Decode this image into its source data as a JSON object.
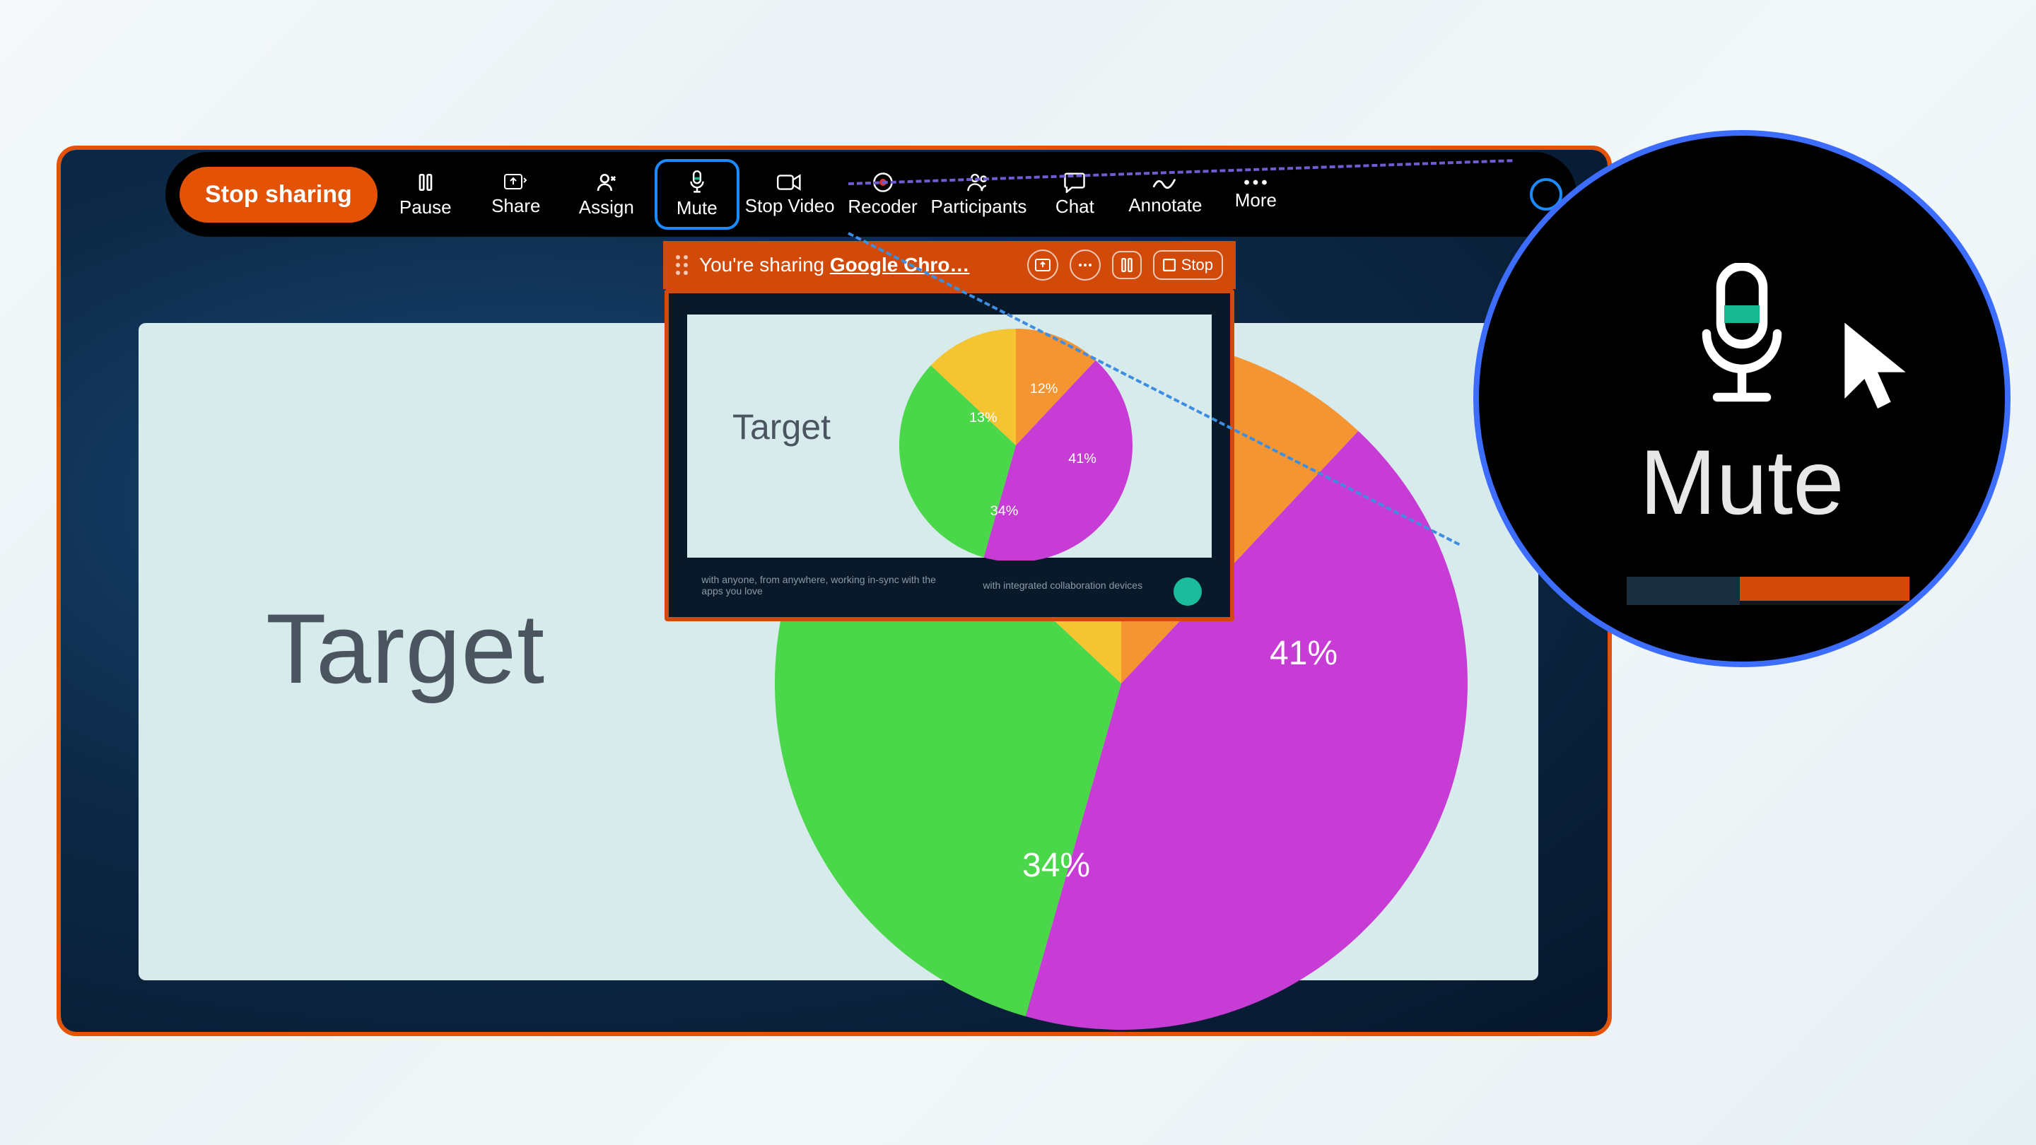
{
  "toolbar": {
    "stop_sharing": "Stop sharing",
    "pause": "Pause",
    "share": "Share",
    "assign": "Assign",
    "mute": "Mute",
    "stop_video": "Stop Video",
    "recorder": "Recoder",
    "participants": "Participants",
    "chat": "Chat",
    "annotate": "Annotate",
    "more": "More"
  },
  "share_indicator": {
    "prefix": "You're sharing ",
    "target": "Google Chro…",
    "stop": "Stop"
  },
  "slide": {
    "title": "Target"
  },
  "preview": {
    "title": "Target",
    "footer_left": "with anyone, from anywhere, working in-sync with the apps you love",
    "footer_right": "with integrated collaboration devices"
  },
  "zoom": {
    "label": "Mute"
  },
  "chart_data": {
    "type": "pie",
    "title": "Target",
    "series": [
      {
        "name": "orange",
        "value": 12,
        "label": "12%",
        "color": "#f59531"
      },
      {
        "name": "magenta",
        "value": 41,
        "label": "41%",
        "color": "#c83cd6"
      },
      {
        "name": "green",
        "value": 34,
        "label": "34%",
        "color": "#4ad74a"
      },
      {
        "name": "yellow",
        "value": 13,
        "label": "13%",
        "color": "#f4c531"
      }
    ]
  },
  "colors": {
    "brand_orange": "#e35205",
    "highlight_blue": "#1a8cff"
  }
}
